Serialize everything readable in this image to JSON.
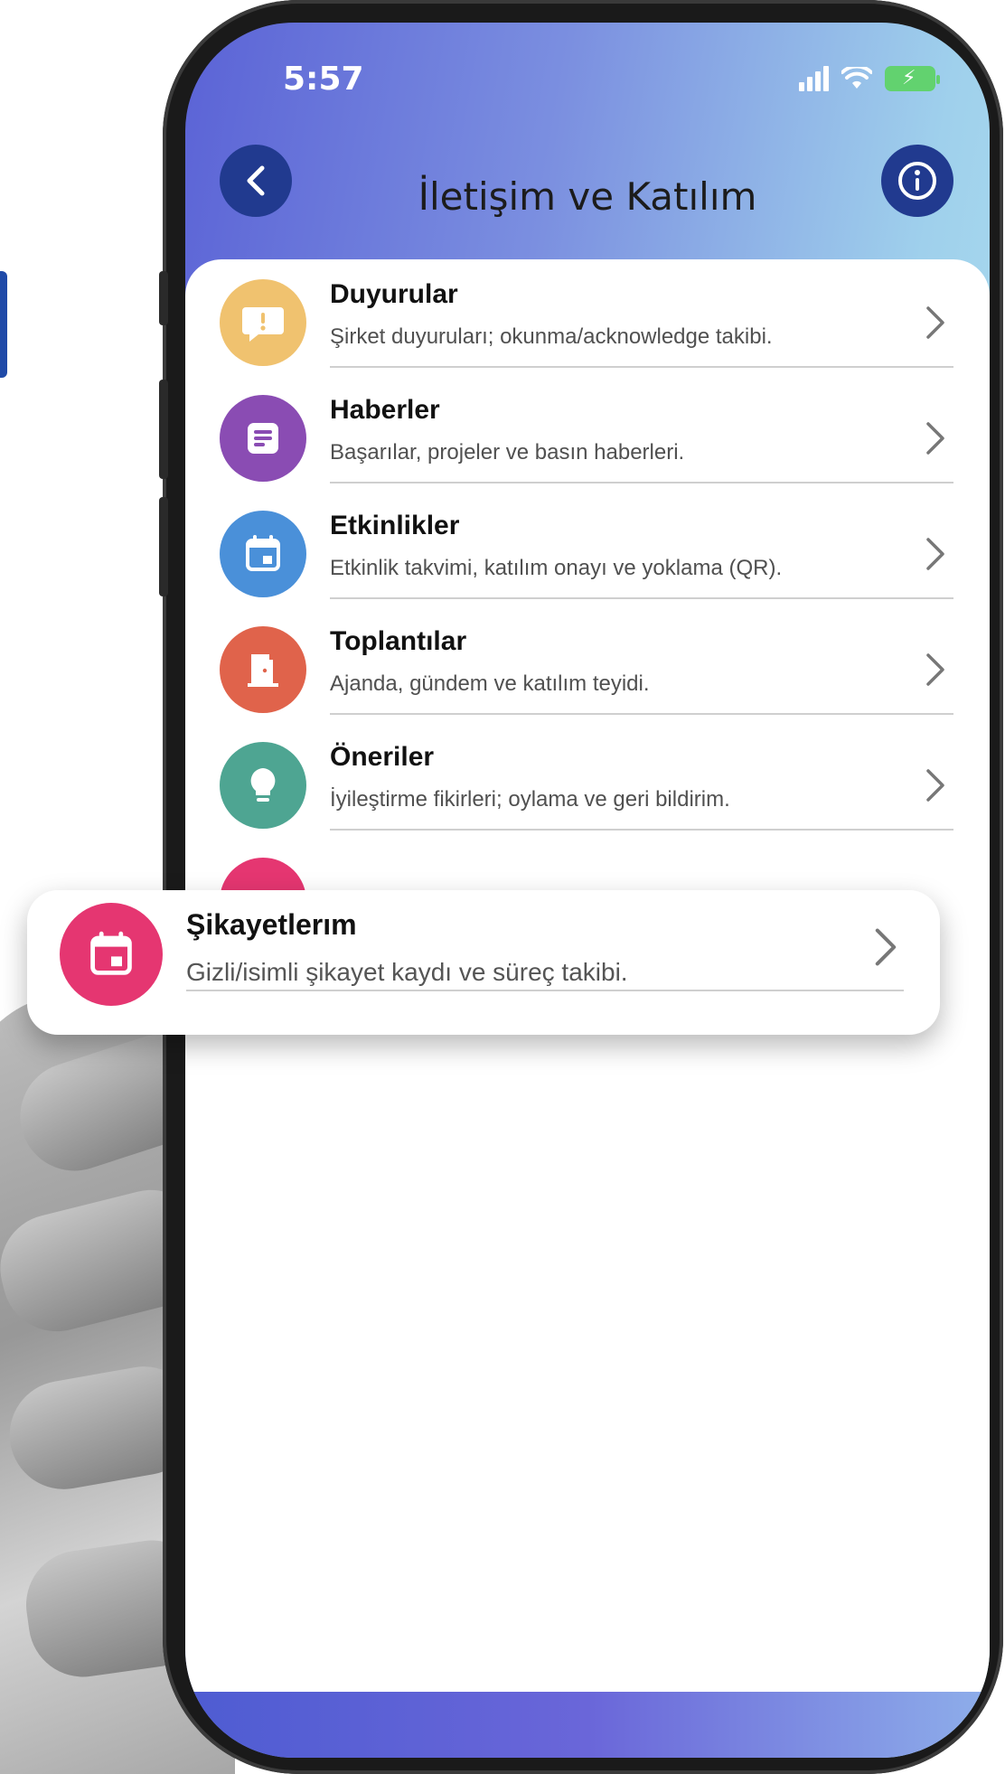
{
  "status_bar": {
    "time": "5:57"
  },
  "header": {
    "title": "İletişim ve Katılım",
    "back_icon": "chevron-left-icon",
    "info_icon": "info-icon"
  },
  "menu": {
    "items": [
      {
        "title": "Duyurular",
        "subtitle": "Şirket duyuruları; okunma/acknowledge takibi.",
        "icon": "announcement-icon",
        "color": "#f0c26f"
      },
      {
        "title": "Haberler",
        "subtitle": "Başarılar, projeler ve basın haberleri.",
        "icon": "news-icon",
        "color": "#8a4cb3"
      },
      {
        "title": "Etkinlikler",
        "subtitle": "Etkinlik takvimi, katılım onayı ve yoklama (QR).",
        "icon": "calendar-icon",
        "color": "#4a90d9"
      },
      {
        "title": "Toplantılar",
        "subtitle": "Ajanda, gündem ve katılım teyidi.",
        "icon": "door-icon",
        "color": "#e0634b"
      },
      {
        "title": "Öneriler",
        "subtitle": "İyileştirme fikirleri; oylama ve geri bildirim.",
        "icon": "lightbulb-icon",
        "color": "#4ea592"
      }
    ],
    "highlight": {
      "title": "Şikayetlerım",
      "subtitle": "Gizli/isimli şikayet kaydı ve süreç takibi.",
      "icon": "calendar-icon",
      "color": "#e53671"
    }
  },
  "colors": {
    "header_button": "#213a8f",
    "accent_left": "#1f4aa8",
    "battery": "#62d26f"
  }
}
